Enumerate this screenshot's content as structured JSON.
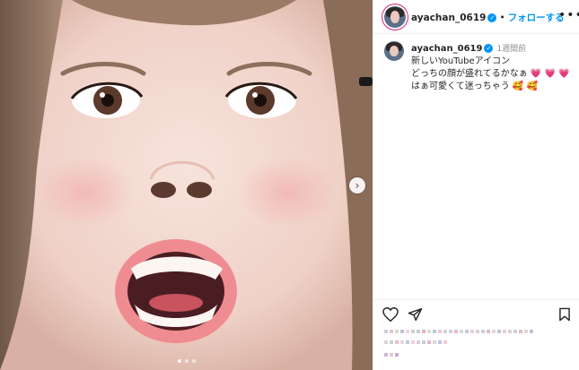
{
  "post": {
    "username": "ayachan_0619",
    "verified_icon": "verified-badge-icon",
    "separator": "•",
    "follow_label": "フォローする",
    "more_label": "•••",
    "caption_user": "ayachan_0619",
    "time_ago": "1週間前",
    "caption_lines": [
      "新しいYouTubeアイコン",
      "どっちの顔が盛れてるかなぁ 💗 💗 💗",
      "はぁ可愛くて迷っちゃう 🥰 🥰"
    ]
  },
  "carousel": {
    "next_label": "›",
    "dot_count": 3,
    "active_dot": 1
  },
  "colors": {
    "accent": "#0095f6",
    "story_ring": "#d62976",
    "text": "#262626",
    "muted": "#8e8e8e"
  },
  "icons": [
    "heart-outline-icon",
    "send-icon",
    "bookmark-icon",
    "chevron-right-icon",
    "more-icon"
  ]
}
